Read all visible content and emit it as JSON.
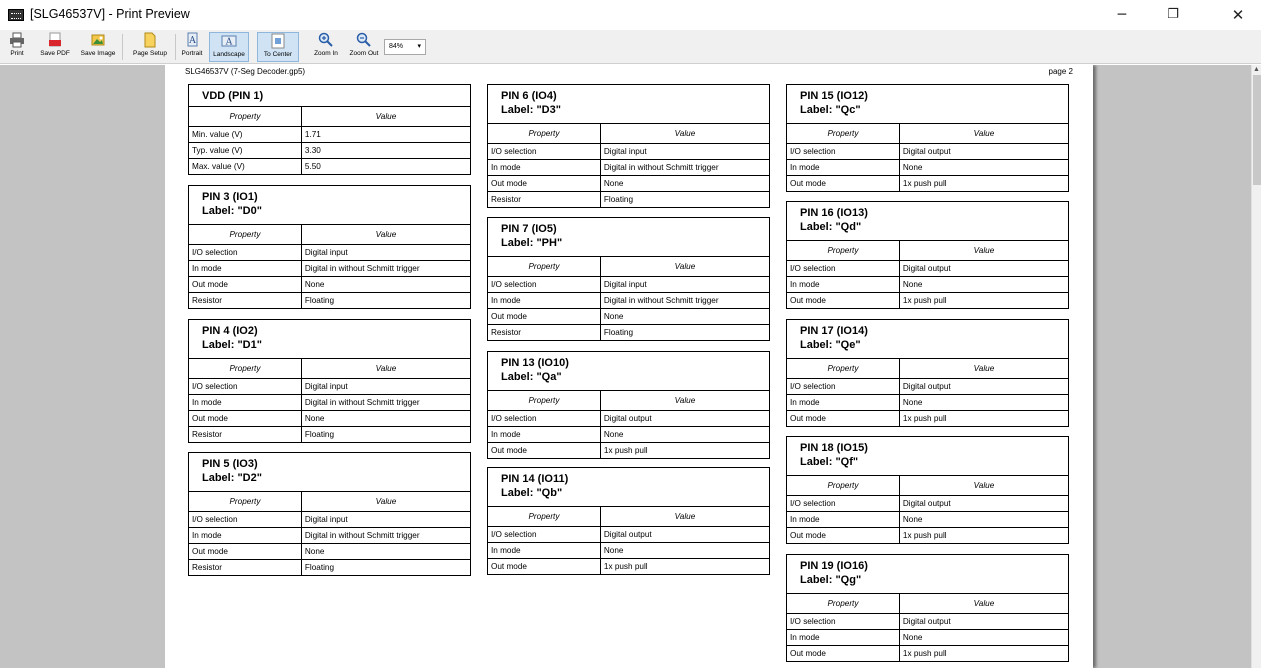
{
  "window": {
    "title": "[SLG46537V] - Print Preview",
    "minimize": "─",
    "maximize": "❐",
    "close": "✕"
  },
  "toolbar": {
    "print": "Print",
    "save_pdf": "Save PDF",
    "save_image": "Save Image",
    "page_setup": "Page Setup",
    "portrait": "Portrait",
    "landscape": "Landscape",
    "to_center": "To Center",
    "zoom_in": "Zoom In",
    "zoom_out": "Zoom Out",
    "zoom_value": "84%"
  },
  "page": {
    "header": "SLG46537V (7-Seg Decoder.gp5)",
    "page_label": "page 2"
  },
  "columns": {
    "property": "Property",
    "value": "Value"
  },
  "cards": [
    {
      "title": "VDD (PIN 1)",
      "label": "",
      "rows": [
        [
          "Min. value (V)",
          "1.71"
        ],
        [
          "Typ. value (V)",
          "3.30"
        ],
        [
          "Max. value (V)",
          "5.50"
        ]
      ]
    },
    {
      "title": "PIN 3 (IO1)",
      "label": "Label: \"D0\"",
      "rows": [
        [
          "I/O selection",
          "Digital input"
        ],
        [
          "In mode",
          "Digital in without Schmitt trigger"
        ],
        [
          "Out mode",
          "None"
        ],
        [
          "Resistor",
          "Floating"
        ]
      ]
    },
    {
      "title": "PIN 4 (IO2)",
      "label": "Label: \"D1\"",
      "rows": [
        [
          "I/O selection",
          "Digital input"
        ],
        [
          "In mode",
          "Digital in without Schmitt trigger"
        ],
        [
          "Out mode",
          "None"
        ],
        [
          "Resistor",
          "Floating"
        ]
      ]
    },
    {
      "title": "PIN 5 (IO3)",
      "label": "Label: \"D2\"",
      "rows": [
        [
          "I/O selection",
          "Digital input"
        ],
        [
          "In mode",
          "Digital in without Schmitt trigger"
        ],
        [
          "Out mode",
          "None"
        ],
        [
          "Resistor",
          "Floating"
        ]
      ]
    },
    {
      "title": "PIN 6 (IO4)",
      "label": "Label: \"D3\"",
      "rows": [
        [
          "I/O selection",
          "Digital input"
        ],
        [
          "In mode",
          "Digital in without Schmitt trigger"
        ],
        [
          "Out mode",
          "None"
        ],
        [
          "Resistor",
          "Floating"
        ]
      ]
    },
    {
      "title": "PIN 7 (IO5)",
      "label": "Label: \"PH\"",
      "rows": [
        [
          "I/O selection",
          "Digital input"
        ],
        [
          "In mode",
          "Digital in without Schmitt trigger"
        ],
        [
          "Out mode",
          "None"
        ],
        [
          "Resistor",
          "Floating"
        ]
      ]
    },
    {
      "title": "PIN 13 (IO10)",
      "label": "Label: \"Qa\"",
      "rows": [
        [
          "I/O selection",
          "Digital output"
        ],
        [
          "In mode",
          "None"
        ],
        [
          "Out mode",
          "1x push pull"
        ]
      ]
    },
    {
      "title": "PIN 14 (IO11)",
      "label": "Label: \"Qb\"",
      "rows": [
        [
          "I/O selection",
          "Digital output"
        ],
        [
          "In mode",
          "None"
        ],
        [
          "Out mode",
          "1x push pull"
        ]
      ]
    },
    {
      "title": "PIN 15 (IO12)",
      "label": "Label: \"Qc\"",
      "rows": [
        [
          "I/O selection",
          "Digital output"
        ],
        [
          "In mode",
          "None"
        ],
        [
          "Out mode",
          "1x push pull"
        ]
      ]
    },
    {
      "title": "PIN 16 (IO13)",
      "label": "Label: \"Qd\"",
      "rows": [
        [
          "I/O selection",
          "Digital output"
        ],
        [
          "In mode",
          "None"
        ],
        [
          "Out mode",
          "1x push pull"
        ]
      ]
    },
    {
      "title": "PIN 17 (IO14)",
      "label": "Label: \"Qe\"",
      "rows": [
        [
          "I/O selection",
          "Digital output"
        ],
        [
          "In mode",
          "None"
        ],
        [
          "Out mode",
          "1x push pull"
        ]
      ]
    },
    {
      "title": "PIN 18 (IO15)",
      "label": "Label: \"Qf\"",
      "rows": [
        [
          "I/O selection",
          "Digital output"
        ],
        [
          "In mode",
          "None"
        ],
        [
          "Out mode",
          "1x push pull"
        ]
      ]
    },
    {
      "title": "PIN 19 (IO16)",
      "label": "Label: \"Qg\"",
      "rows": [
        [
          "I/O selection",
          "Digital output"
        ],
        [
          "In mode",
          "None"
        ],
        [
          "Out mode",
          "1x push pull"
        ]
      ]
    }
  ]
}
